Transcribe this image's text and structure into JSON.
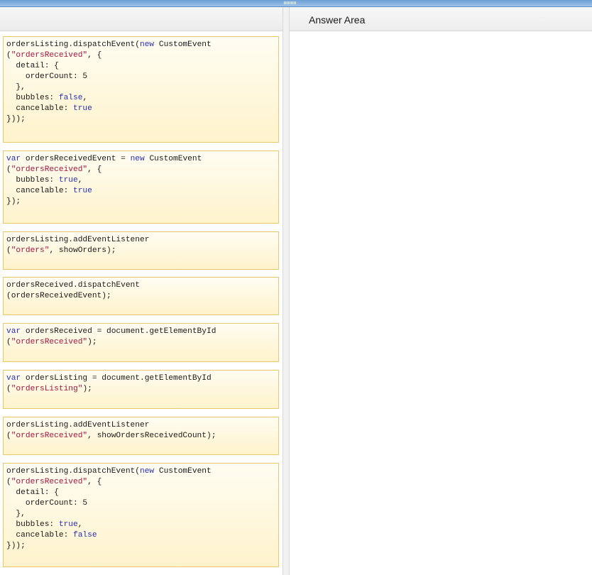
{
  "answer_area": {
    "title": "Answer Area"
  },
  "cards": [
    {
      "id": "card-1",
      "lines": [
        [
          [
            "ordersListing.dispatchEvent(",
            "p"
          ],
          [
            "new",
            "k"
          ],
          [
            " CustomEvent",
            "p"
          ]
        ],
        [
          [
            "(",
            "p"
          ],
          [
            "\"ordersReceived\"",
            "s"
          ],
          [
            ", {",
            "p"
          ]
        ],
        [
          [
            "  detail: {",
            "p"
          ]
        ],
        [
          [
            "    orderCount: 5",
            "p"
          ]
        ],
        [
          [
            "  },",
            "p"
          ]
        ],
        [
          [
            "  bubbles: ",
            "p"
          ],
          [
            "false",
            "k"
          ],
          [
            ",",
            "p"
          ]
        ],
        [
          [
            "  cancelable: ",
            "p"
          ],
          [
            "true",
            "k"
          ]
        ],
        [
          [
            "}));",
            "p"
          ]
        ]
      ]
    },
    {
      "id": "card-2",
      "lines": [
        [
          [
            "var",
            "k"
          ],
          [
            " ordersReceivedEvent = ",
            "p"
          ],
          [
            "new",
            "k"
          ],
          [
            " CustomEvent",
            "p"
          ]
        ],
        [
          [
            "(",
            "p"
          ],
          [
            "\"ordersReceived\"",
            "s"
          ],
          [
            ", {",
            "p"
          ]
        ],
        [
          [
            "  bubbles: ",
            "p"
          ],
          [
            "true",
            "k"
          ],
          [
            ",",
            "p"
          ]
        ],
        [
          [
            "  cancelable: ",
            "p"
          ],
          [
            "true",
            "k"
          ]
        ],
        [
          [
            "});",
            "p"
          ]
        ]
      ]
    },
    {
      "id": "card-3",
      "lines": [
        [
          [
            "ordersListing.addEventListener",
            "p"
          ]
        ],
        [
          [
            "(",
            "p"
          ],
          [
            "\"orders\"",
            "s"
          ],
          [
            ", showOrders);",
            "p"
          ]
        ]
      ]
    },
    {
      "id": "card-4",
      "lines": [
        [
          [
            "ordersReceived.dispatchEvent",
            "p"
          ]
        ],
        [
          [
            "(ordersReceivedEvent);",
            "p"
          ]
        ]
      ]
    },
    {
      "id": "card-5",
      "lines": [
        [
          [
            "var",
            "k"
          ],
          [
            " ordersReceived = document.getElementById",
            "p"
          ]
        ],
        [
          [
            "(",
            "p"
          ],
          [
            "\"ordersReceived\"",
            "s"
          ],
          [
            ");",
            "p"
          ]
        ]
      ]
    },
    {
      "id": "card-6",
      "lines": [
        [
          [
            "var",
            "k"
          ],
          [
            " ordersListing = document.getElementById",
            "p"
          ]
        ],
        [
          [
            "(",
            "p"
          ],
          [
            "\"ordersListing\"",
            "s"
          ],
          [
            ");",
            "p"
          ]
        ]
      ]
    },
    {
      "id": "card-7",
      "lines": [
        [
          [
            "ordersListing.addEventListener",
            "p"
          ]
        ],
        [
          [
            "(",
            "p"
          ],
          [
            "\"ordersReceived\"",
            "s"
          ],
          [
            ", showOrdersReceivedCount);",
            "p"
          ]
        ]
      ]
    },
    {
      "id": "card-8",
      "lines": [
        [
          [
            "ordersListing.dispatchEvent(",
            "p"
          ],
          [
            "new",
            "k"
          ],
          [
            " CustomEvent",
            "p"
          ]
        ],
        [
          [
            "(",
            "p"
          ],
          [
            "\"ordersReceived\"",
            "s"
          ],
          [
            ", {",
            "p"
          ]
        ],
        [
          [
            "  detail: {",
            "p"
          ]
        ],
        [
          [
            "    orderCount: 5",
            "p"
          ]
        ],
        [
          [
            "  },",
            "p"
          ]
        ],
        [
          [
            "  bubbles: ",
            "p"
          ],
          [
            "true",
            "k"
          ],
          [
            ",",
            "p"
          ]
        ],
        [
          [
            "  cancelable: ",
            "p"
          ],
          [
            "false",
            "k"
          ]
        ],
        [
          [
            "}));",
            "p"
          ]
        ]
      ]
    }
  ]
}
